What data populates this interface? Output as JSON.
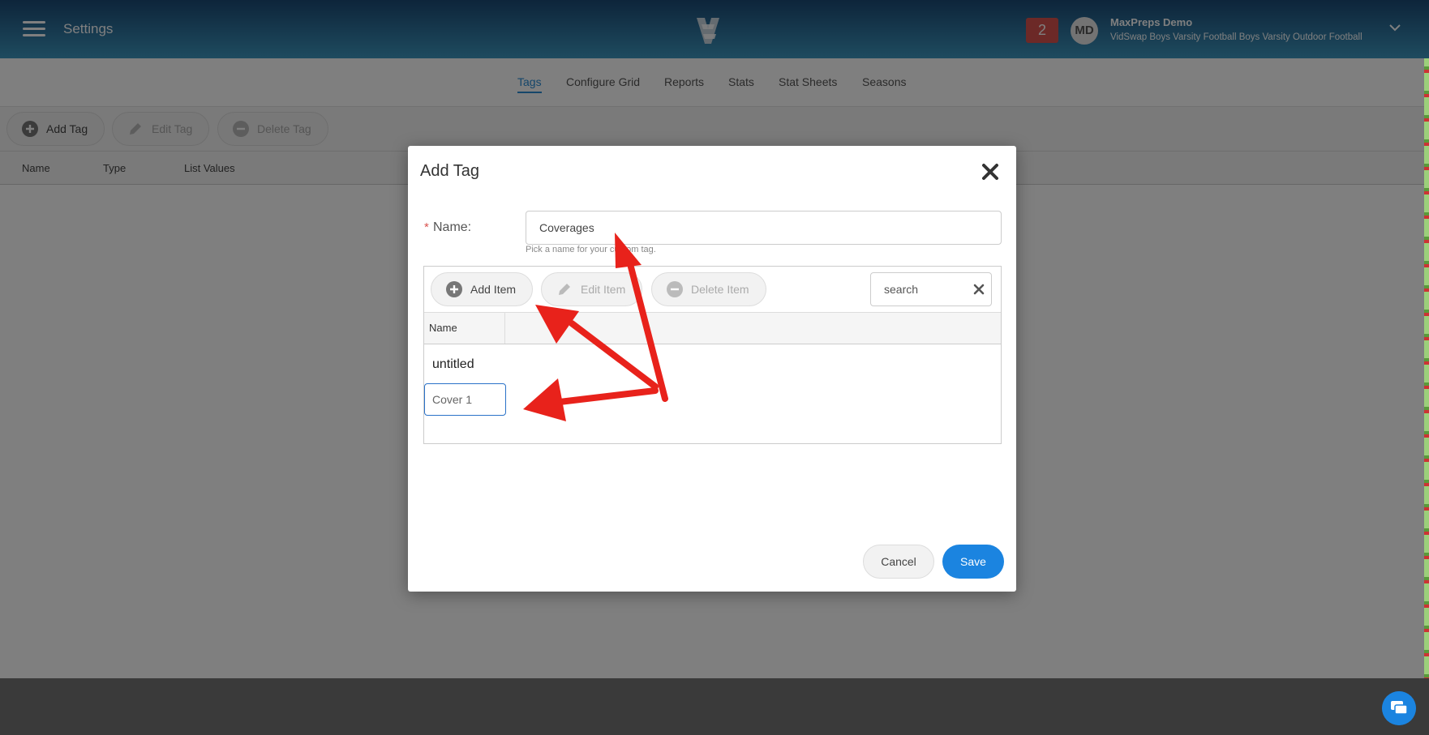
{
  "header": {
    "title": "Settings",
    "notification_count": "2",
    "avatar_initials": "MD",
    "user_name": "MaxPreps Demo",
    "team_name": "VidSwap Boys Varsity Football Boys Varsity Outdoor Football"
  },
  "subnav": {
    "tabs": [
      {
        "label": "Tags",
        "active": true
      },
      {
        "label": "Configure Grid"
      },
      {
        "label": "Reports"
      },
      {
        "label": "Stats"
      },
      {
        "label": "Stat Sheets"
      },
      {
        "label": "Seasons"
      }
    ]
  },
  "toolbar": {
    "add_label": "Add Tag",
    "edit_label": "Edit Tag",
    "delete_label": "Delete Tag"
  },
  "table": {
    "columns": [
      "Name",
      "Type",
      "List Values"
    ]
  },
  "modal": {
    "title": "Add Tag",
    "required_mark": "*",
    "name_label": "Name:",
    "name_value": "Coverages",
    "name_help": "Pick a name for your custom tag.",
    "items": {
      "add_label": "Add Item",
      "edit_label": "Edit Item",
      "delete_label": "Delete Item",
      "search_placeholder": "search",
      "column_header": "Name",
      "rows": [
        "untitled"
      ],
      "editing_value": "Cover 1"
    },
    "cancel_label": "Cancel",
    "save_label": "Save"
  },
  "colors": {
    "accent": "#2a8dd4",
    "primary_button": "#1b84e0",
    "notification_badge": "#d9534f",
    "annotation_arrow": "#e8221b"
  }
}
